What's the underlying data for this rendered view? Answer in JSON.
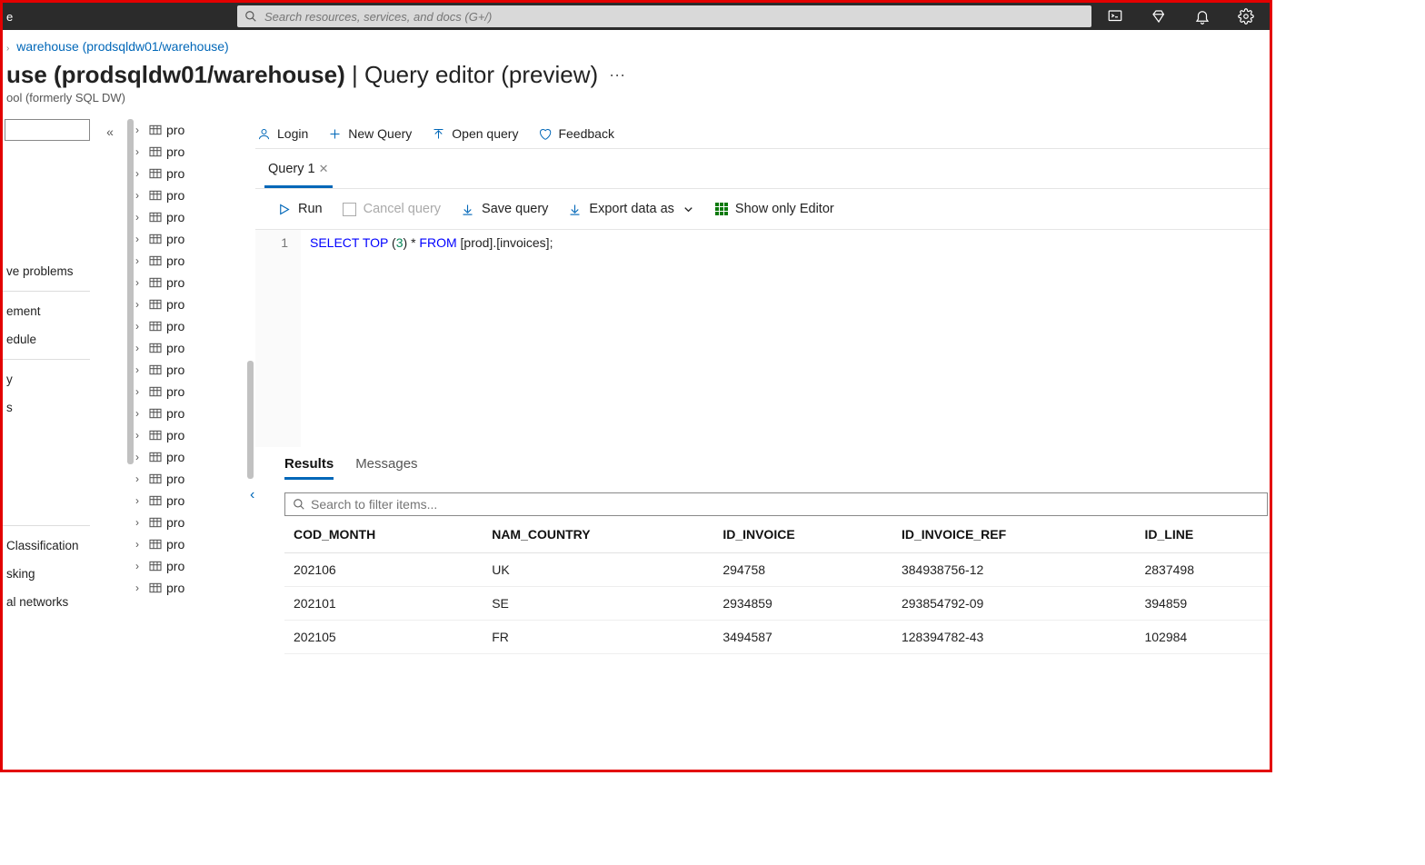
{
  "topbar": {
    "left_text": "e",
    "search_placeholder": "Search resources, services, and docs (G+/)"
  },
  "breadcrumb": {
    "link_text": "warehouse (prodsqldw01/warehouse)"
  },
  "title": {
    "main": "use (prodsqldw01/warehouse)",
    "secondary": " | Query editor (preview)",
    "subtitle": "ool (formerly SQL DW)"
  },
  "toolbar": {
    "login": "Login",
    "new_query": "New Query",
    "open_query": "Open query",
    "feedback": "Feedback"
  },
  "leftnav": {
    "items_a": [
      "ve problems"
    ],
    "items_b": [
      "ement",
      "edule"
    ],
    "items_c": [
      "y",
      "s"
    ],
    "items_d": [
      "Classification",
      "sking",
      "al networks"
    ]
  },
  "tree": {
    "item_label": "pro"
  },
  "tab": {
    "label": "Query 1"
  },
  "actionbar": {
    "run": "Run",
    "cancel": "Cancel query",
    "save": "Save query",
    "export": "Export data as",
    "show_editor": "Show only Editor"
  },
  "editor": {
    "line_no": "1",
    "sql": {
      "p1": "SELECT",
      "p2": "TOP",
      "p3": "(",
      "p4": "3",
      "p5": ")",
      "p6": "*",
      "p7": "FROM",
      "p8": "[prod].[invoices];"
    }
  },
  "results": {
    "tab_results": "Results",
    "tab_messages": "Messages",
    "filter_placeholder": "Search to filter items...",
    "columns": [
      "COD_MONTH",
      "NAM_COUNTRY",
      "ID_INVOICE",
      "ID_INVOICE_REF",
      "ID_LINE"
    ],
    "rows": [
      [
        "202106",
        "UK",
        "294758",
        "384938756-12",
        "2837498"
      ],
      [
        "202101",
        "SE",
        "2934859",
        "293854792-09",
        "394859"
      ],
      [
        "202105",
        "FR",
        "3494587",
        "128394782-43",
        "102984"
      ]
    ]
  }
}
